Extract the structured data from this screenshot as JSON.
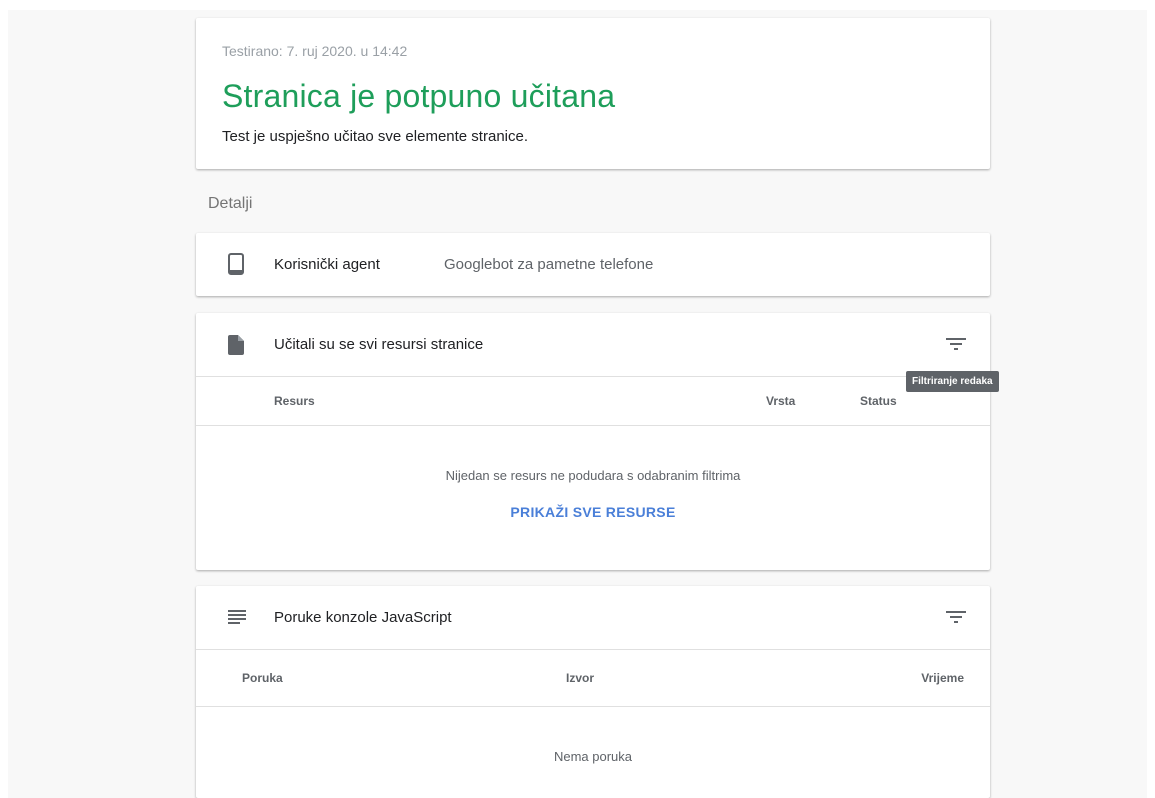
{
  "summary": {
    "tested": "Testirano: 7. ruj 2020. u 14:42",
    "headline": "Stranica je potpuno učitana",
    "description": "Test je uspješno učitao sve elemente stranice."
  },
  "details_title": "Detalji",
  "user_agent": {
    "label": "Korisnički agent",
    "value": "Googlebot za pametne telefone",
    "icon": "smartphone-icon"
  },
  "resources": {
    "title": "Učitali su se svi resursi stranice",
    "icon": "document-icon",
    "filter_icon": "filter-icon",
    "columns": [
      "Resurs",
      "Vrsta",
      "Status"
    ],
    "empty_message": "Nijedan se resurs ne podudara s odabranim filtrima",
    "show_all_label": "PRIKAŽI SVE RESURSE",
    "tooltip": "Filtriranje redaka"
  },
  "console": {
    "title": "Poruke konzole JavaScript",
    "icon": "notes-icon",
    "filter_icon": "filter-icon",
    "columns": [
      "Poruka",
      "Izvor",
      "Vrijeme"
    ],
    "empty_message": "Nema poruka"
  },
  "colors": {
    "success": "#1e9e5a",
    "link": "#4a7fd8",
    "tooltip_bg": "#5f6368"
  }
}
